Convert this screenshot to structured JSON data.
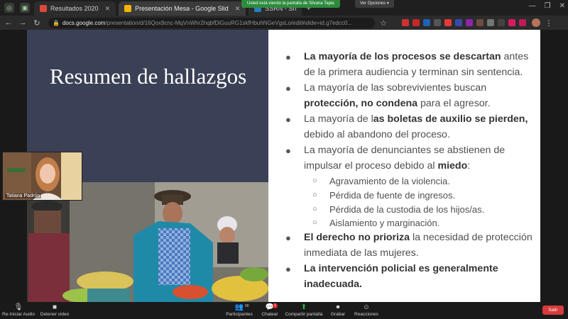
{
  "browser": {
    "tabs": [
      {
        "label": "Resultados 2020",
        "active": false,
        "color": "#d94a3a"
      },
      {
        "label": "Presentación Mesa - Google Slid",
        "active": true,
        "color": "#f4b400"
      },
      {
        "label": "SSRN - Sh",
        "active": false,
        "color": "#2a7fb8"
      }
    ],
    "new_tab_icon": "plus-icon",
    "url_host": "docs.google.com",
    "url_path": "/presentation/d/16Qox9cnc-MqVnWhr2hqbfDiGuuRG1skfHbuhNGeVgsLo/edit#slide=id.g7edcc0..."
  },
  "share": {
    "banner": "Usted está viendo la pantalla de Silvana Tapia",
    "options_label": "Ver Opciones"
  },
  "slide": {
    "title": "Resumen de hallazgos",
    "bullets": [
      {
        "type": "main",
        "parts": [
          {
            "t": "La mayoría de los procesos se descartan",
            "b": true
          },
          {
            "t": " antes de la primera audiencia y terminan sin sentencia.",
            "b": false
          }
        ]
      },
      {
        "type": "main",
        "parts": [
          {
            "t": "La mayoría de las sobrevivientes buscan ",
            "b": false
          },
          {
            "t": "protección, no condena",
            "b": true
          },
          {
            "t": " para el agresor.",
            "b": false
          }
        ]
      },
      {
        "type": "main",
        "parts": [
          {
            "t": "La mayoría de l",
            "b": false
          },
          {
            "t": "as boletas de auxilio se pierden,",
            "b": true
          },
          {
            "t": " debido al abandono del proceso.",
            "b": false
          }
        ]
      },
      {
        "type": "main",
        "parts": [
          {
            "t": "La mayoría de denunciantes se abstienen de impulsar el proceso debido al ",
            "b": false
          },
          {
            "t": "miedo",
            "b": true
          },
          {
            "t": ":",
            "b": false
          }
        ]
      },
      {
        "type": "sub",
        "parts": [
          {
            "t": "Agravamiento de la violencia.",
            "b": false
          }
        ]
      },
      {
        "type": "sub",
        "parts": [
          {
            "t": "Pérdida de fuente de ingresos.",
            "b": false
          }
        ]
      },
      {
        "type": "sub",
        "parts": [
          {
            "t": "Pérdida de la custodia de los hijos/as.",
            "b": false
          }
        ]
      },
      {
        "type": "sub",
        "parts": [
          {
            "t": "Aislamiento y marginación.",
            "b": false
          }
        ]
      },
      {
        "type": "main",
        "parts": [
          {
            "t": "El derecho no prioriza",
            "b": true
          },
          {
            "t": " la necesidad de protección inmediata de las mujeres.",
            "b": false
          }
        ]
      },
      {
        "type": "main",
        "parts": [
          {
            "t": "La intervención policial es generalmente inadecuada.",
            "b": true
          }
        ]
      }
    ]
  },
  "webcam": {
    "name": "Tatiana Padrón"
  },
  "zoom": {
    "items": [
      {
        "label": "Re-Iniciar Audio",
        "icon": "microphone-muted-icon",
        "glyph": "🎙"
      },
      {
        "label": "Detener video",
        "icon": "video-camera-icon",
        "glyph": "■"
      },
      {
        "label": "Participantes",
        "icon": "participants-icon",
        "glyph": "👥"
      },
      {
        "label": "Chatear",
        "icon": "chat-icon",
        "glyph": "💬"
      },
      {
        "label": "Compartir pantalla",
        "icon": "share-screen-icon",
        "glyph": "⬆"
      },
      {
        "label": "Grabar",
        "icon": "record-icon",
        "glyph": "⏺"
      },
      {
        "label": "Reacciones",
        "icon": "reactions-icon",
        "glyph": "☺"
      }
    ],
    "participants_count": "90",
    "chat_badge": "1",
    "leave_label": "Salir"
  },
  "colors": {
    "slide_left_bg": "#3a4055",
    "share_green": "#2e8b3e",
    "leave_red": "#d83b3b"
  }
}
